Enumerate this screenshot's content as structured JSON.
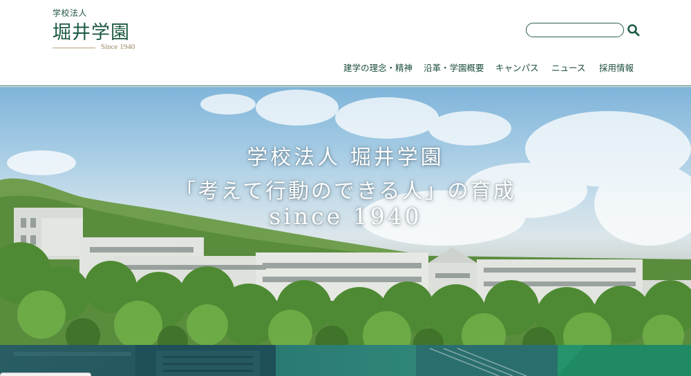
{
  "logo": {
    "subtitle": "学校法人",
    "name": "堀井学園",
    "since": "Since 1940"
  },
  "search": {
    "placeholder": "",
    "icon": "search-icon"
  },
  "nav": {
    "items": [
      {
        "label": "建学の理念・精神"
      },
      {
        "label": "沿革・学園概要"
      },
      {
        "label": "キャンパス"
      },
      {
        "label": "ニュース"
      },
      {
        "label": "採用情報"
      }
    ]
  },
  "hero": {
    "line1": "学校法人 堀井学園",
    "line2": "「考えて行動のできる人」の育成",
    "line3": "since 1940"
  },
  "colors": {
    "brand": "#1c5a42",
    "accent_gold": "#b79f72",
    "tile_dark": "#1f5b63",
    "tile_teal": "#2a8476",
    "tile_green": "#1f8a64"
  }
}
